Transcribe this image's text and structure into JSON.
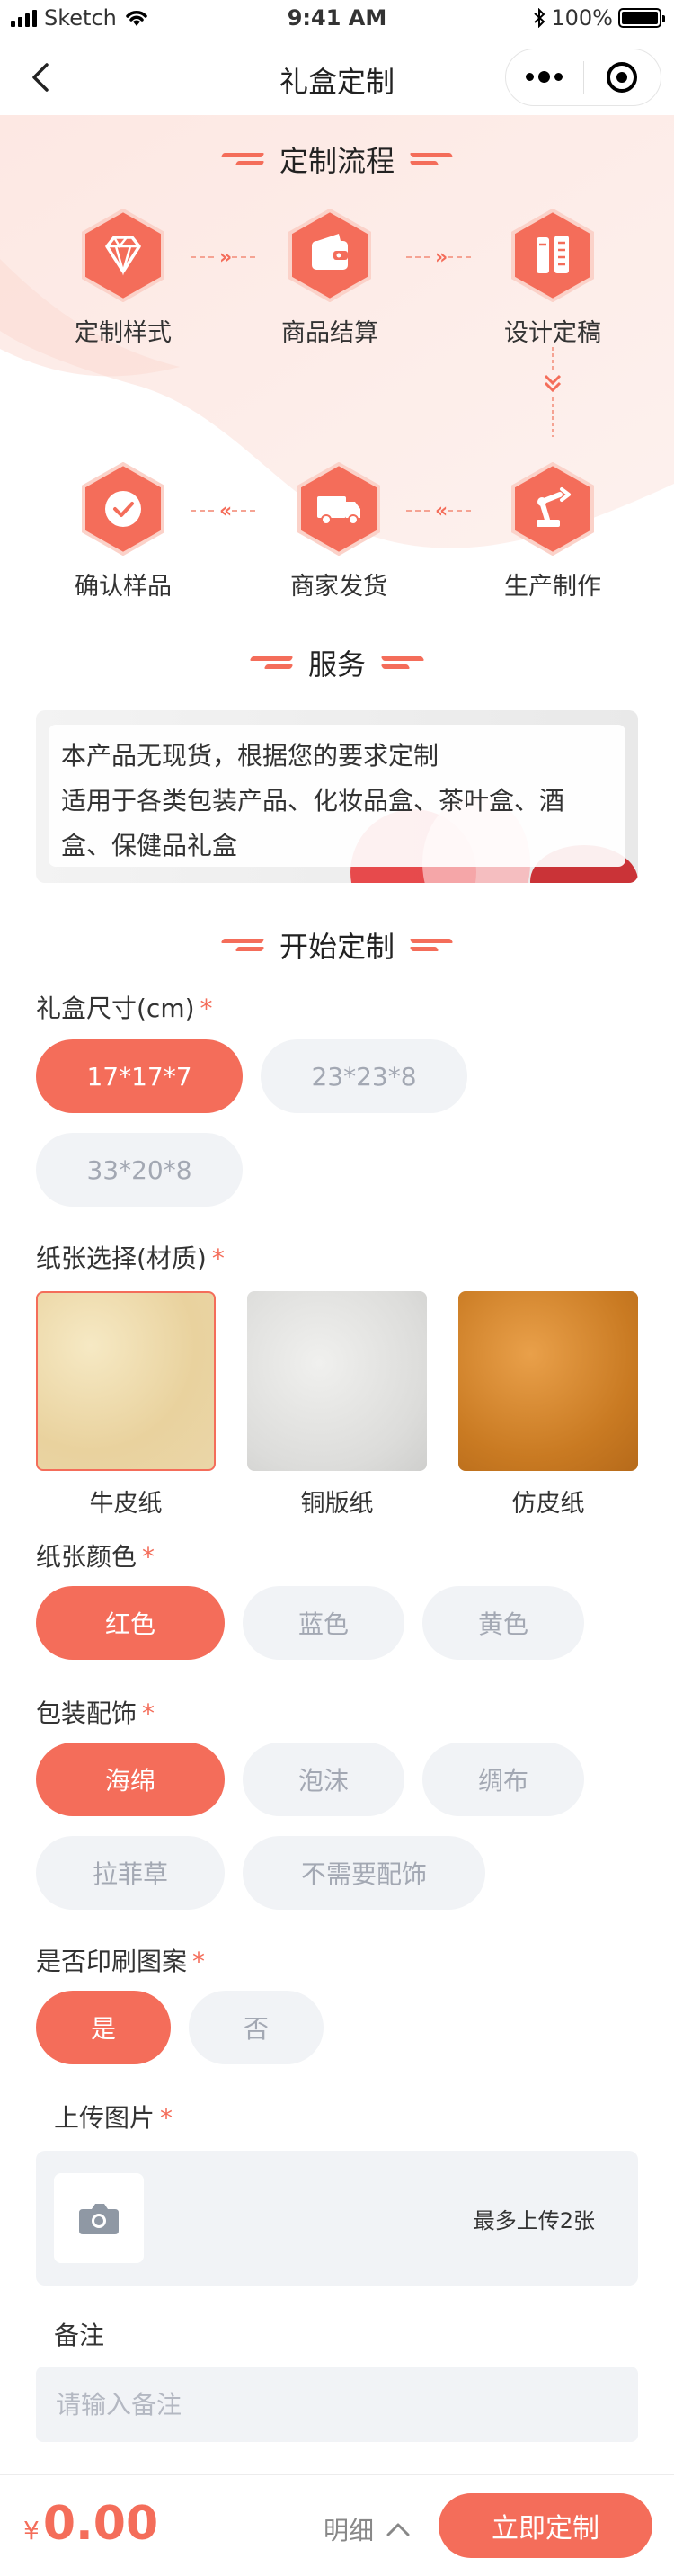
{
  "status_bar": {
    "carrier": "Sketch",
    "time": "9:41 AM",
    "battery": "100%"
  },
  "nav": {
    "title": "礼盒定制"
  },
  "process": {
    "title": "定制流程",
    "steps": [
      {
        "label": "定制样式",
        "icon": "diamond-icon"
      },
      {
        "label": "商品结算",
        "icon": "wallet-icon"
      },
      {
        "label": "设计定稿",
        "icon": "design-icon"
      },
      {
        "label": "确认样品",
        "icon": "check-icon"
      },
      {
        "label": "商家发货",
        "icon": "truck-icon"
      },
      {
        "label": "生产制作",
        "icon": "robot-arm-icon"
      }
    ]
  },
  "service": {
    "title": "服务",
    "lines": [
      "本产品无现货，根据您的要求定制",
      "适用于各类包装产品、化妆品盒、茶叶盒、酒",
      "盒、保健品礼盒"
    ]
  },
  "customize": {
    "title": "开始定制",
    "size": {
      "label": "礼盒尺寸(cm)",
      "required": "*",
      "options": [
        "17*17*7",
        "23*23*8",
        "33*20*8"
      ],
      "selected": "17*17*7"
    },
    "paper": {
      "label": "纸张选择(材质)",
      "required": "*",
      "options": [
        "牛皮纸",
        "铜版纸",
        "仿皮纸"
      ],
      "selected": "牛皮纸"
    },
    "color": {
      "label": "纸张颜色",
      "required": "*",
      "options": [
        "红色",
        "蓝色",
        "黄色"
      ],
      "selected": "红色"
    },
    "accessory": {
      "label": "包装配饰",
      "required": "*",
      "options": [
        "海绵",
        "泡沫",
        "绸布",
        "拉菲草",
        "不需要配饰"
      ],
      "selected": "海绵"
    },
    "print": {
      "label": "是否印刷图案",
      "required": "*",
      "options": [
        "是",
        "否"
      ],
      "selected": "是"
    },
    "upload": {
      "label": "上传图片",
      "required": "*",
      "hint": "最多上传2张"
    },
    "remark": {
      "label": "备注",
      "placeholder": "请输入备注"
    }
  },
  "footer": {
    "currency": "¥",
    "price": "0.00",
    "detail": "明细",
    "order_button": "立即定制"
  },
  "colors": {
    "accent": "#f46d5a",
    "chip_bg": "#f1f3f6",
    "chip_text": "#a3a8b3"
  }
}
